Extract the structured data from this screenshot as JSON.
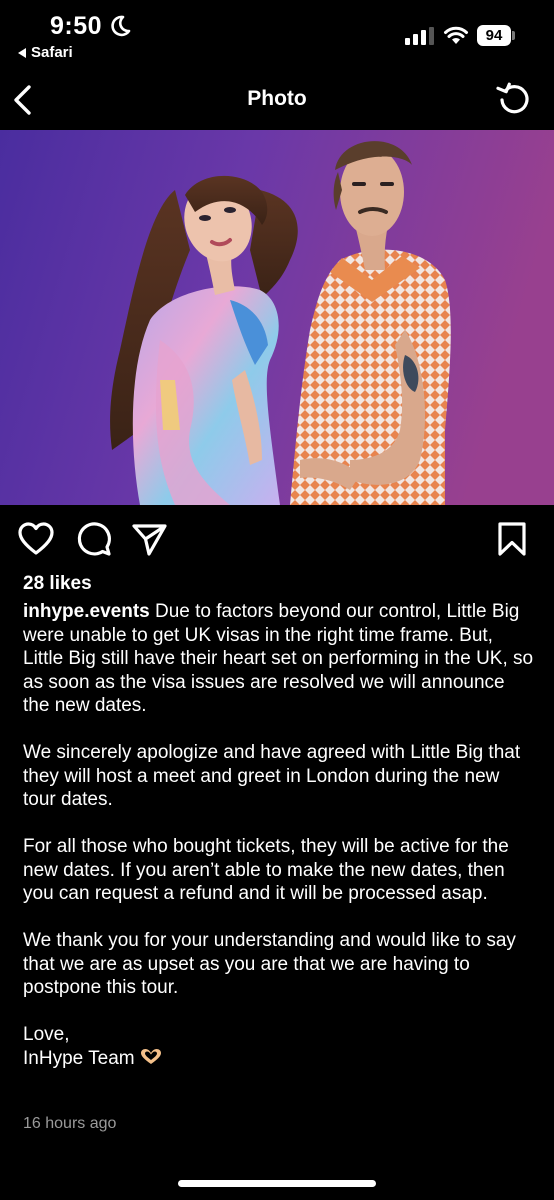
{
  "status_bar": {
    "time": "9:50",
    "back_app": "Safari",
    "battery": "94"
  },
  "nav": {
    "title": "Photo"
  },
  "post": {
    "likes": "28 likes",
    "username": "inhype.events",
    "paragraph_1": "Due to factors beyond our control, Little Big were unable to get UK visas in the right time frame. But, Little Big still have their heart set on performing in the UK, so as soon as the visa issues are resolved we will announce the new dates.",
    "paragraph_2": "We sincerely apologize and have agreed with Little Big that they will host a meet and greet in London during the new tour dates.",
    "paragraph_3": "For all those who bought tickets, they will be active for the new dates. If you aren’t able to make the new dates, then you can request a refund and it will be processed asap.",
    "paragraph_4": "We thank you for your understanding and would like to say that we are as upset as you are that we are having to postpone this tour.",
    "sign_off_1": "Love,",
    "sign_off_2": "InHype Team",
    "timestamp": "16 hours ago"
  },
  "icons": {
    "like": "heart-icon",
    "comment": "comment-icon",
    "share": "send-icon",
    "save": "bookmark-icon",
    "back": "chevron-left-icon",
    "refresh": "refresh-icon",
    "emoji": "heart-hands-icon"
  },
  "colors": {
    "background": "#000000",
    "text": "#ffffff",
    "muted": "#9a9a9a",
    "photo_bg": "#6b3aa8"
  }
}
